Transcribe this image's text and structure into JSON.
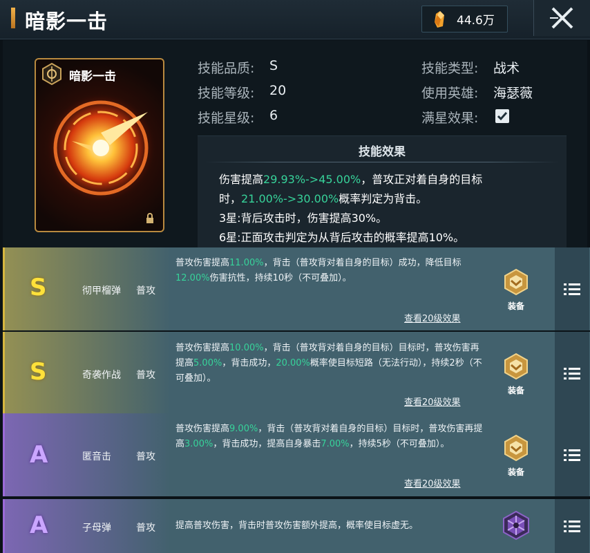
{
  "header": {
    "title": "暗影一击",
    "currency_value": "44.6万",
    "currency_icon": "crystal-icon",
    "close_icon": "close-icon"
  },
  "card": {
    "title": "暗影一击",
    "emblem_icon": "emblem-icon",
    "lock_icon": "lock-icon"
  },
  "info": {
    "quality_label": "技能品质:",
    "quality_value": "S",
    "level_label": "技能等级:",
    "level_value": "20",
    "star_label": "技能星级:",
    "star_value": "6",
    "type_label": "技能类型:",
    "type_value": "战术",
    "hero_label": "使用英雄:",
    "hero_value": "海瑟薇",
    "full_star_label": "满星效果:",
    "full_star_checked": true
  },
  "effect": {
    "title": "技能效果",
    "line1_a": "伤害提高",
    "line1_b": "29.93%->45.00%",
    "line1_c": "，普攻正对着自身的目标",
    "line2_a": "时，",
    "line2_b": "21.00%->30.00%",
    "line2_c": "概率判定为背击。",
    "line3": "3星:背后攻击时，伤害提高30%。",
    "line4": "6星:正面攻击判定为从背后攻击的概率提高10%。"
  },
  "rows": [
    {
      "grade": "S",
      "name": "彻甲榴弹",
      "type": "普攻",
      "desc_parts": [
        "普攻伤害提高",
        "11.00%",
        "，背击（普攻背对着自身的目标）成功，降低目标",
        "12.00%",
        "伤害抗性，持续10秒（不可叠加）。"
      ],
      "link": "查看20级效果",
      "equip_label": "装备"
    },
    {
      "grade": "S",
      "name": "奇袭作战",
      "type": "普攻",
      "desc_parts": [
        "普攻伤害提高",
        "10.00%",
        "，背击（普攻背对着自身的目标）目标时，普攻伤害再提高",
        "5.00%",
        "，背击成功，",
        "20.00%",
        "概率使目标短路（无法行动），持续2秒（不可叠加）。"
      ],
      "link": "查看20级效果",
      "equip_label": "装备"
    },
    {
      "grade": "A",
      "name": "匿音击",
      "type": "普攻",
      "desc_parts": [
        "普攻伤害提高",
        "9.00%",
        "，背击（普攻背对着自身的目标）目标时，普攻伤害再提高",
        "3.00%",
        "，背击成功，提高自身暴击",
        "7.00%",
        "，持续5秒（不可叠加）。"
      ],
      "link": "查看20级效果",
      "equip_label": "装备"
    },
    {
      "grade": "A",
      "name": "子母弹",
      "type": "普攻",
      "desc_parts": [
        "提高普攻伤害，背击时普攻伤害额外提高，概率使目标虚无。"
      ]
    }
  ],
  "icons": {
    "equip": "equip-shield-icon",
    "locked": "hexagon-lock-icon",
    "menu": "list-menu-icon",
    "check": "checkmark-icon"
  },
  "colors": {
    "highlight_green": "#37d39a",
    "grade_s": "#ffe13a",
    "grade_a": "#caa6ff",
    "row_bg": "#42616d"
  }
}
